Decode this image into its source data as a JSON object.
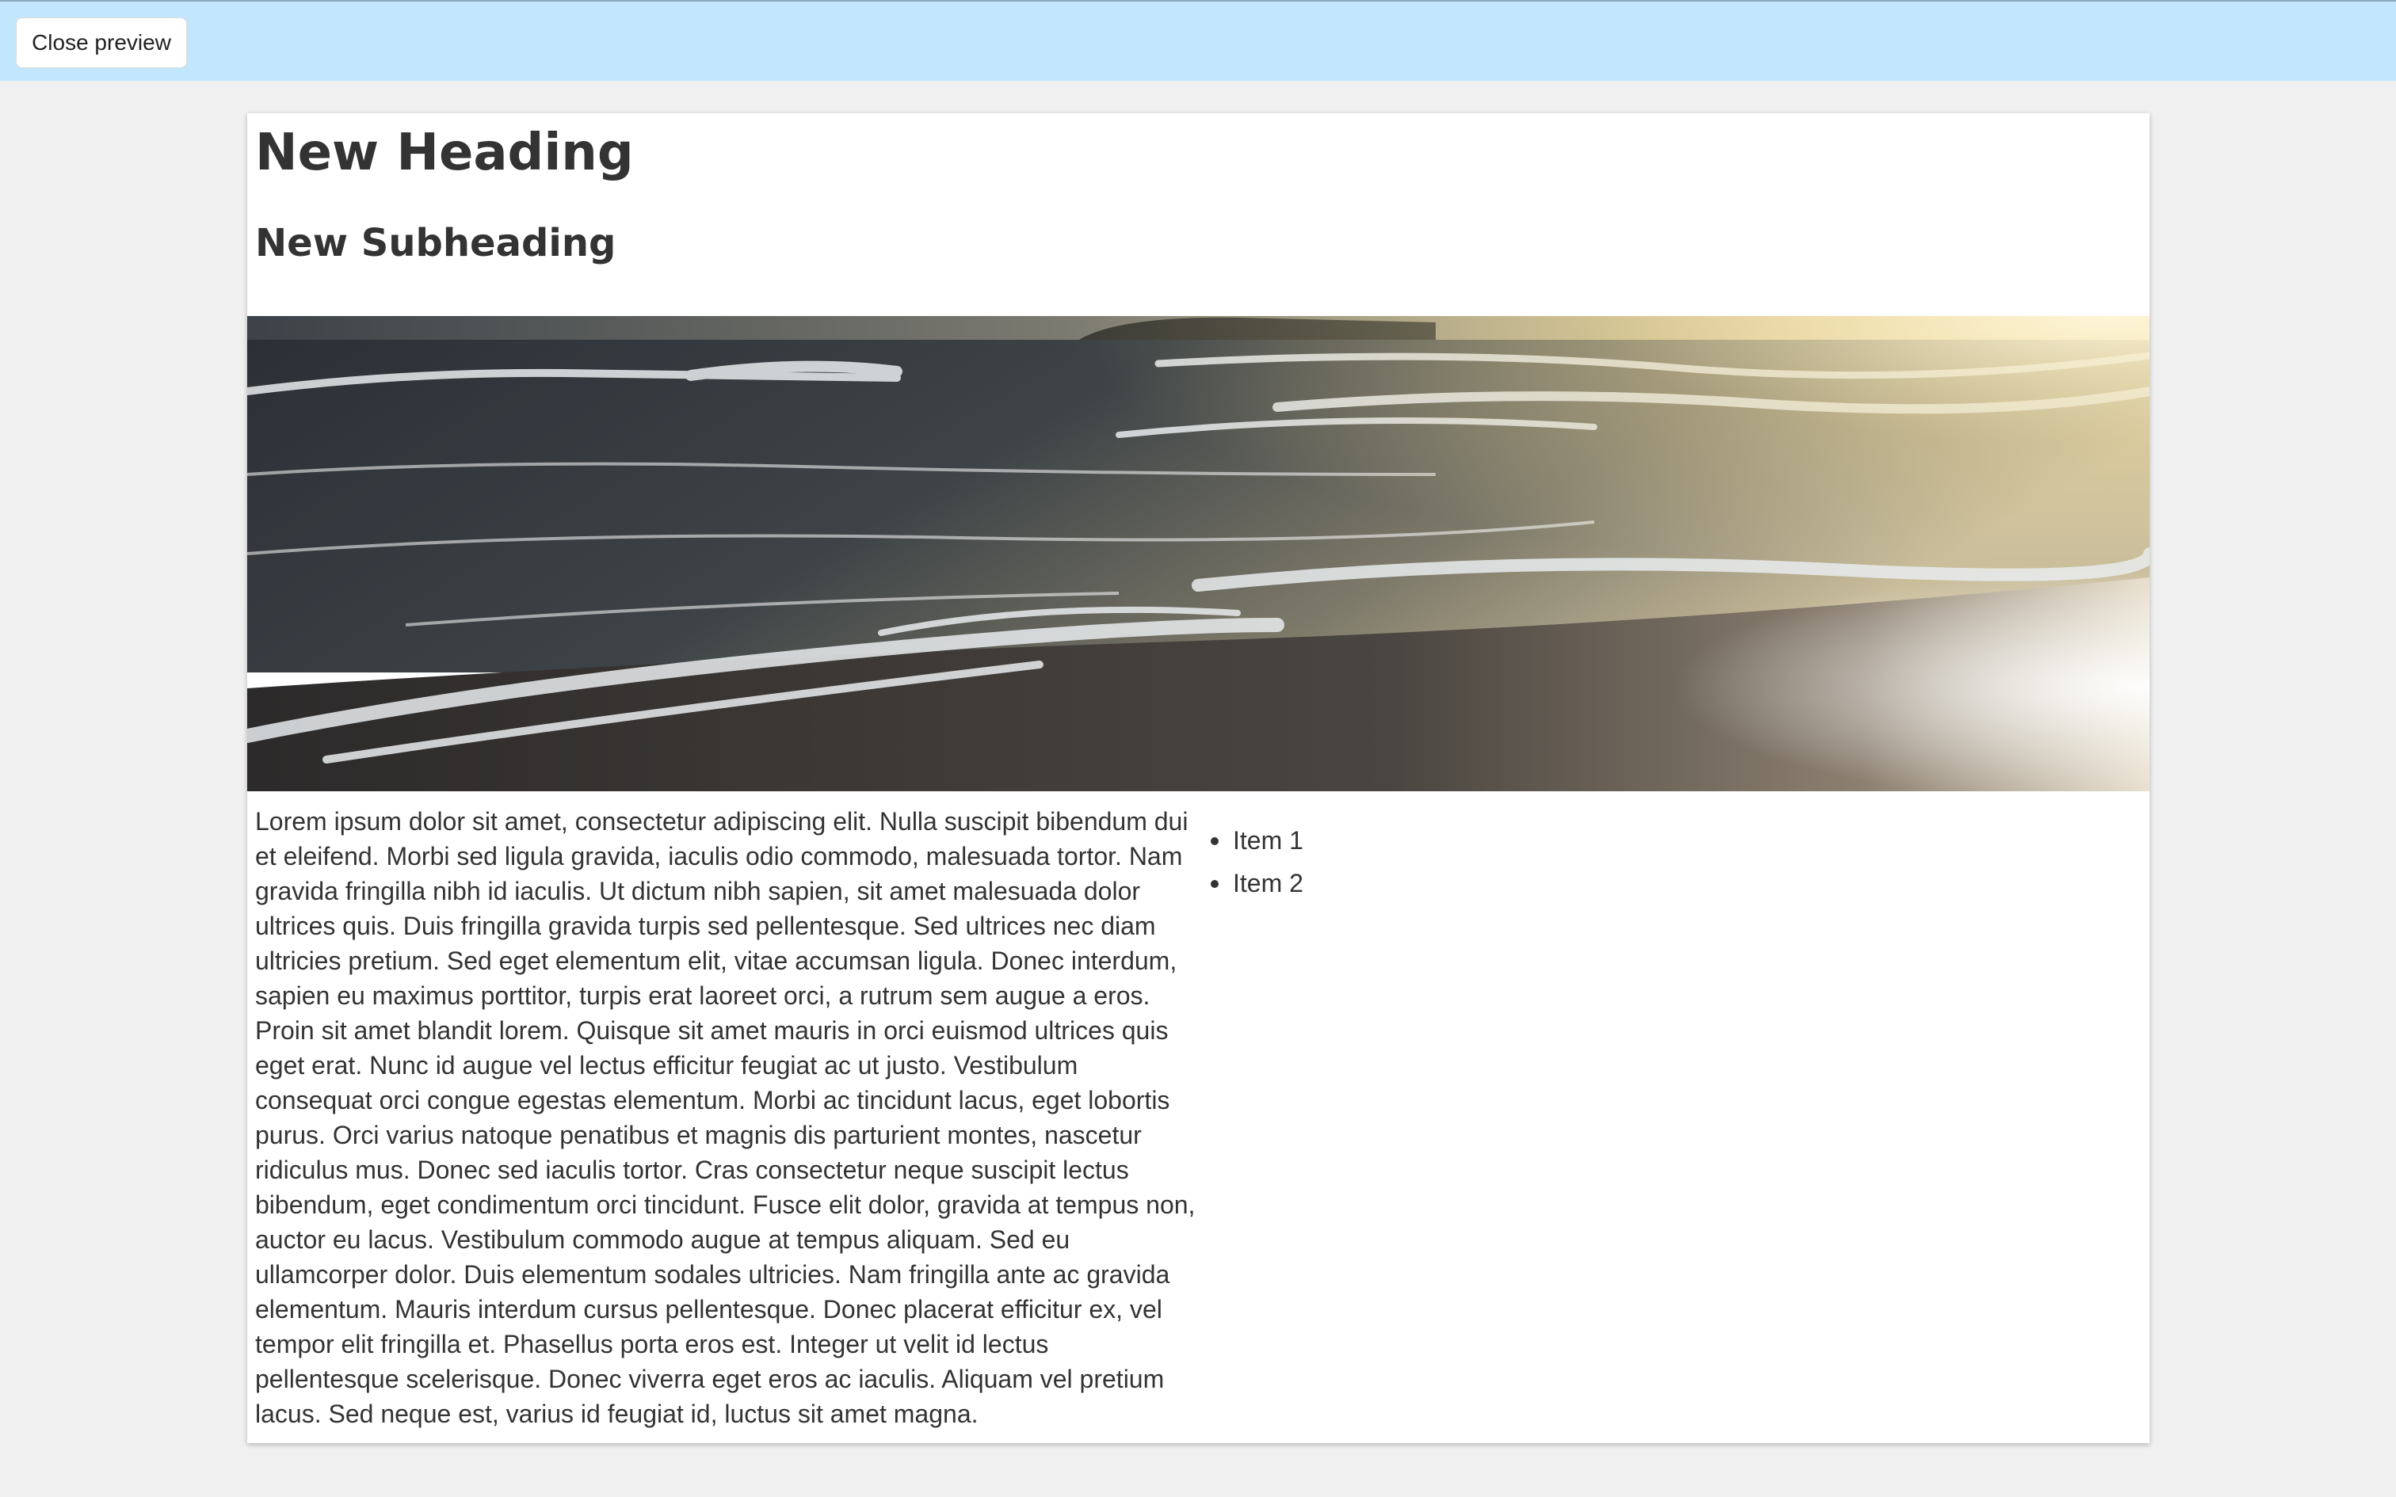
{
  "toolbar": {
    "close_label": "Close preview"
  },
  "content": {
    "heading": "New Heading",
    "subheading": "New Subheading",
    "image_alt": "Ocean waves breaking on a sandy beach at sunset",
    "paragraph": "Lorem ipsum dolor sit amet, consectetur adipiscing elit. Nulla suscipit bibendum dui et eleifend. Morbi sed ligula gravida, iaculis odio commodo, malesuada tortor. Nam gravida fringilla nibh id iaculis. Ut dictum nibh sapien, sit amet malesuada dolor ultrices quis. Duis fringilla gravida turpis sed pellentesque. Sed ultrices nec diam ultricies pretium. Sed eget elementum elit, vitae accumsan ligula. Donec interdum, sapien eu maximus porttitor, turpis erat laoreet orci, a rutrum sem augue a eros. Proin sit amet blandit lorem. Quisque sit amet mauris in orci euismod ultrices quis eget erat. Nunc id augue vel lectus efficitur feugiat ac ut justo. Vestibulum consequat orci congue egestas elementum. Morbi ac tincidunt lacus, eget lobortis purus. Orci varius natoque penatibus et magnis dis parturient montes, nascetur ridiculus mus. Donec sed iaculis tortor. Cras consectetur neque suscipit lectus bibendum, eget condimentum orci tincidunt. Fusce elit dolor, gravida at tempus non, auctor eu lacus. Vestibulum commodo augue at tempus aliquam. Sed eu ullamcorper dolor. Duis elementum sodales ultricies. Nam fringilla ante ac gravida elementum. Mauris interdum cursus pellentesque. Donec placerat efficitur ex, vel tempor elit fringilla et. Phasellus porta eros est. Integer ut velit id lectus pellentesque scelerisque. Donec viverra eget eros ac iaculis. Aliquam vel pretium lacus. Sed neque est, varius id feugiat id, luctus sit amet magna.",
    "list_items": [
      "Item 1",
      "Item 2"
    ]
  },
  "colors": {
    "topbar_bg": "#c2e6fb",
    "page_bg": "#f0f0f0",
    "card_bg": "#ffffff",
    "text": "#333333"
  }
}
